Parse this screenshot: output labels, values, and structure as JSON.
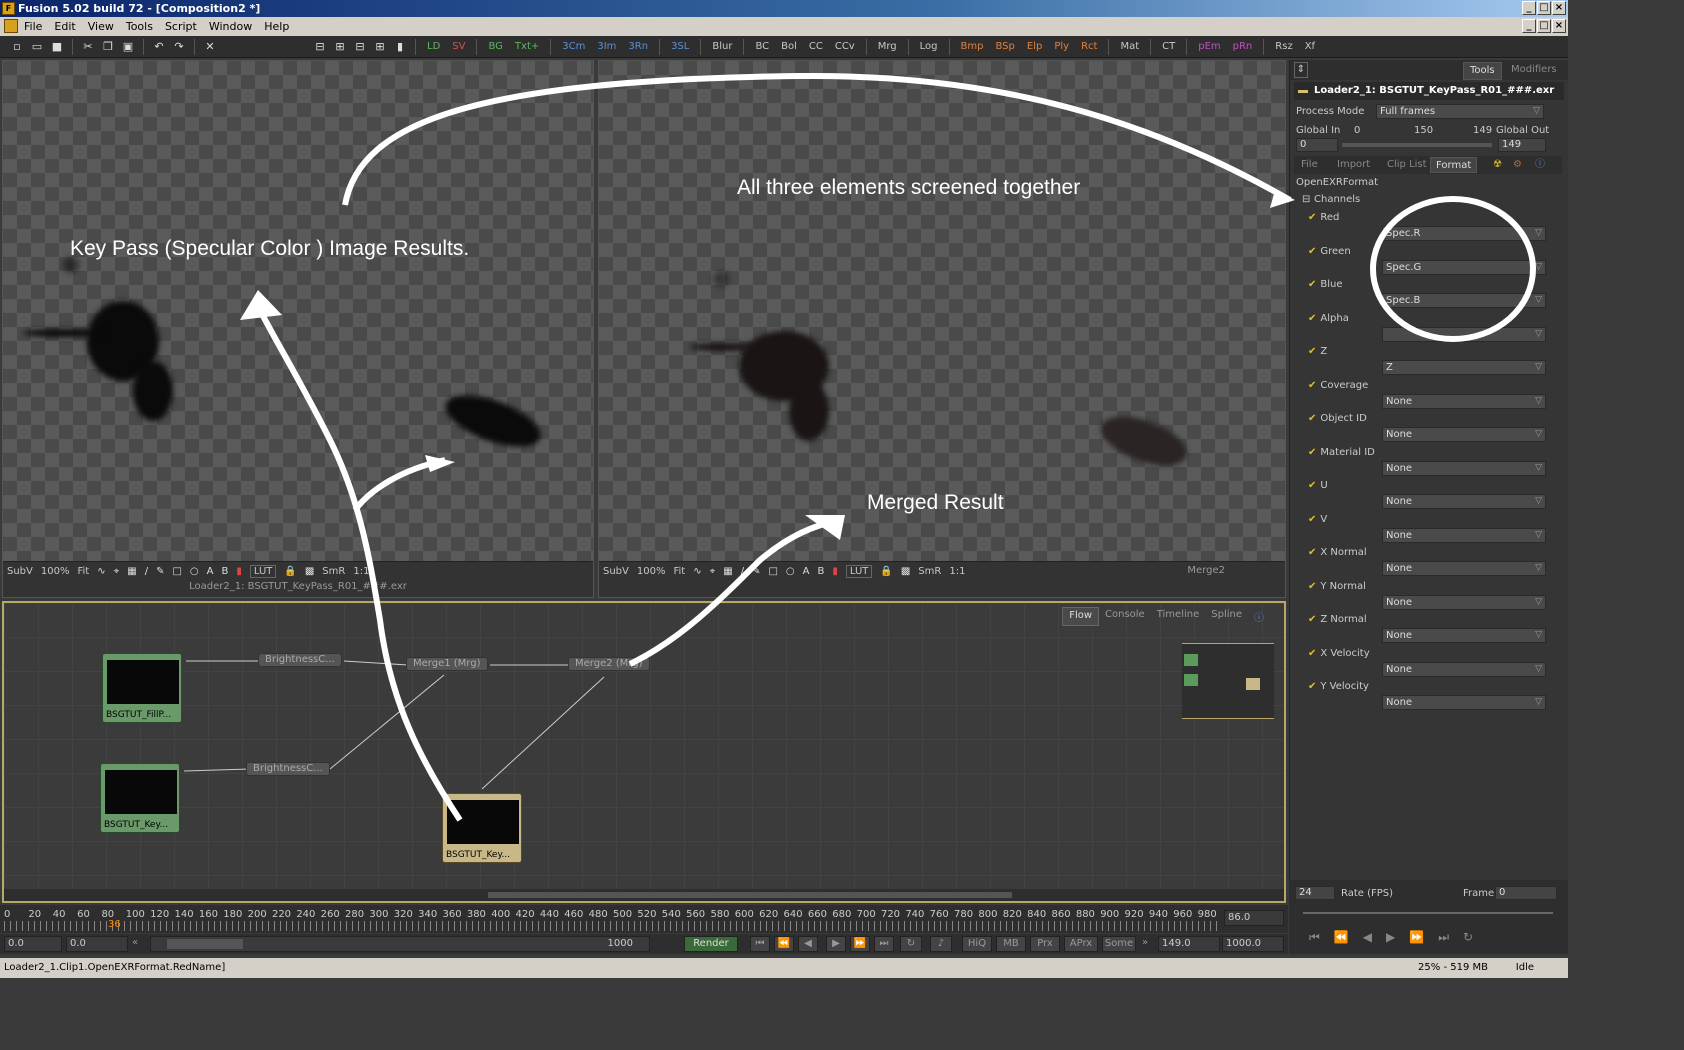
{
  "window": {
    "title": "Fusion 5.02 build 72 - [Composition2 *]"
  },
  "menu": [
    "File",
    "Edit",
    "View",
    "Tools",
    "Script",
    "Window",
    "Help"
  ],
  "toolbar": {
    "tools": [
      "LD",
      "SV",
      "BG",
      "Txt+",
      "3Cm",
      "3Im",
      "3Rn",
      "3SL",
      "Blur",
      "BC",
      "Bol",
      "CC",
      "CCv",
      "Mrg",
      "Log",
      "Bmp",
      "BSp",
      "Elp",
      "Ply",
      "Rct",
      "Mat",
      "CT",
      "pEm",
      "pRn",
      "Rsz",
      "Xf"
    ]
  },
  "viewer_left": {
    "subv": "SubV",
    "zoom": "100%",
    "fit": "Fit",
    "lut": "LUT",
    "smr": "SmR",
    "ratio": "1:1",
    "caption": "Loader2_1: BSGTUT_KeyPass_R01_###.exr"
  },
  "viewer_right": {
    "subv": "SubV",
    "zoom": "100%",
    "fit": "Fit",
    "lut": "LUT",
    "smr": "SmR",
    "ratio": "1:1",
    "caption": "Merge2"
  },
  "annotations": {
    "left": "Key Pass (Specular Color ) Image Results.",
    "right_top": "All three elements screened together",
    "merged": "Merged Result"
  },
  "inspector": {
    "tabs": {
      "tools": "Tools",
      "modifiers": "Modifiers"
    },
    "tool_name": "Loader2_1: BSGTUT_KeyPass_R01_###.exr",
    "process_mode_label": "Process Mode",
    "process_mode_value": "Full frames",
    "global_in_label": "Global In",
    "global_out_label": "Global Out",
    "global_in_min": "0",
    "global_mid": "150",
    "global_max": "149",
    "global_in_value": "0",
    "global_out_value": "149",
    "subtabs": [
      "File",
      "Import",
      "Clip List",
      "Format"
    ],
    "format_header": "OpenEXRFormat",
    "channels_header": "Channels",
    "channels": [
      {
        "label": "Red",
        "value": "Spec.R"
      },
      {
        "label": "Green",
        "value": "Spec.G"
      },
      {
        "label": "Blue",
        "value": "Spec.B"
      },
      {
        "label": "Alpha",
        "value": ""
      },
      {
        "label": "Z",
        "value": "Z"
      },
      {
        "label": "Coverage",
        "value": "None"
      },
      {
        "label": "Object ID",
        "value": "None"
      },
      {
        "label": "Material ID",
        "value": "None"
      },
      {
        "label": "U",
        "value": "None"
      },
      {
        "label": "V",
        "value": "None"
      },
      {
        "label": "X Normal",
        "value": "None"
      },
      {
        "label": "Y Normal",
        "value": "None"
      },
      {
        "label": "Z Normal",
        "value": "None"
      },
      {
        "label": "X Velocity",
        "value": "None"
      },
      {
        "label": "Y Velocity",
        "value": "None"
      }
    ]
  },
  "flow": {
    "tabs": [
      "Flow",
      "Console",
      "Timeline",
      "Spline"
    ],
    "nodes": {
      "loader1": "BSGTUT_FillP...",
      "loader2": "BSGTUT_Key...",
      "loader3": "BSGTUT_Key...",
      "bc1": "BrightnessC...",
      "bc2": "BrightnessC...",
      "merge1": "Merge1 (Mrg)",
      "merge2": "Merge2 (Mrg)"
    }
  },
  "timeline": {
    "ticks": [
      "0",
      "20",
      "40",
      "60",
      "80",
      "100",
      "120",
      "140",
      "160",
      "180",
      "200",
      "220",
      "240",
      "260",
      "280",
      "300",
      "320",
      "340",
      "360",
      "380",
      "400",
      "420",
      "440",
      "460",
      "480",
      "500",
      "520",
      "540",
      "560",
      "580",
      "600",
      "620",
      "640",
      "660",
      "680",
      "700",
      "720",
      "740",
      "760",
      "780",
      "800",
      "820",
      "840",
      "860",
      "880",
      "900",
      "920",
      "940",
      "960",
      "980"
    ],
    "current_marker": "36",
    "end_value": "86.0"
  },
  "transport": {
    "start": "0.0",
    "render_start": "0.0",
    "render_end": "1000",
    "render_label": "Render",
    "hiq": "HiQ",
    "mb": "MB",
    "prx": "Prx",
    "aprx": "APrx",
    "some": "Some",
    "current": "149.0",
    "end": "1000.0"
  },
  "rbottom": {
    "fps_value": "24",
    "fps_label": "Rate (FPS)",
    "frame_label": "Frame",
    "frame_value": "0"
  },
  "status": {
    "text": "Loader2_1.Clip1.OpenEXRFormat.RedName]",
    "mem": "25% - 519 MB",
    "state": "Idle"
  }
}
